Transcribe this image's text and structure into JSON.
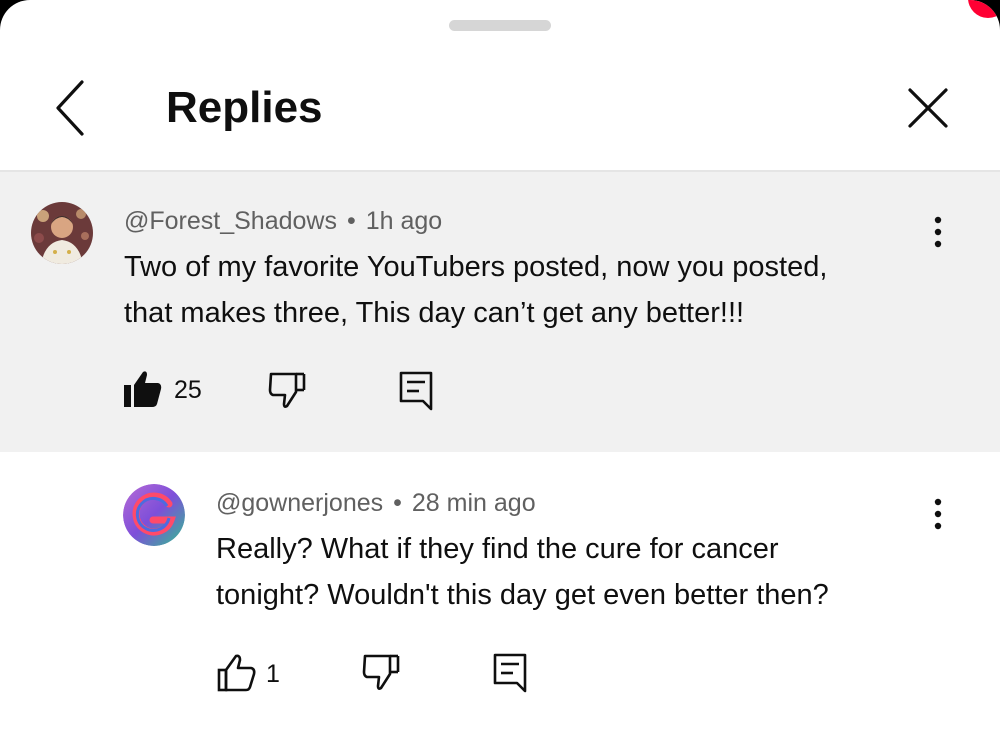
{
  "header": {
    "title": "Replies",
    "back_icon": "chevron-left-icon",
    "close_icon": "close-icon"
  },
  "colors": {
    "accent": "#ff0033",
    "highlight_bg": "#f1f1f1",
    "meta_text": "#606060",
    "primary_text": "#0f0f0f"
  },
  "comments": [
    {
      "author": "@Forest_Shadows",
      "time": "1h ago",
      "text_line1": "Two of my favorite YouTubers posted, now you posted,",
      "text_line2": "that makes three, This day can’t get any better!!!",
      "likes": "25",
      "liked": true,
      "highlighted": true
    },
    {
      "author": "@gownerjones",
      "time": "28 min ago",
      "text_line1": "Really? What if they find the cure for cancer",
      "text_line2": "tonight? Wouldn't this day get even better then?",
      "likes": "1",
      "liked": false,
      "highlighted": false
    }
  ]
}
